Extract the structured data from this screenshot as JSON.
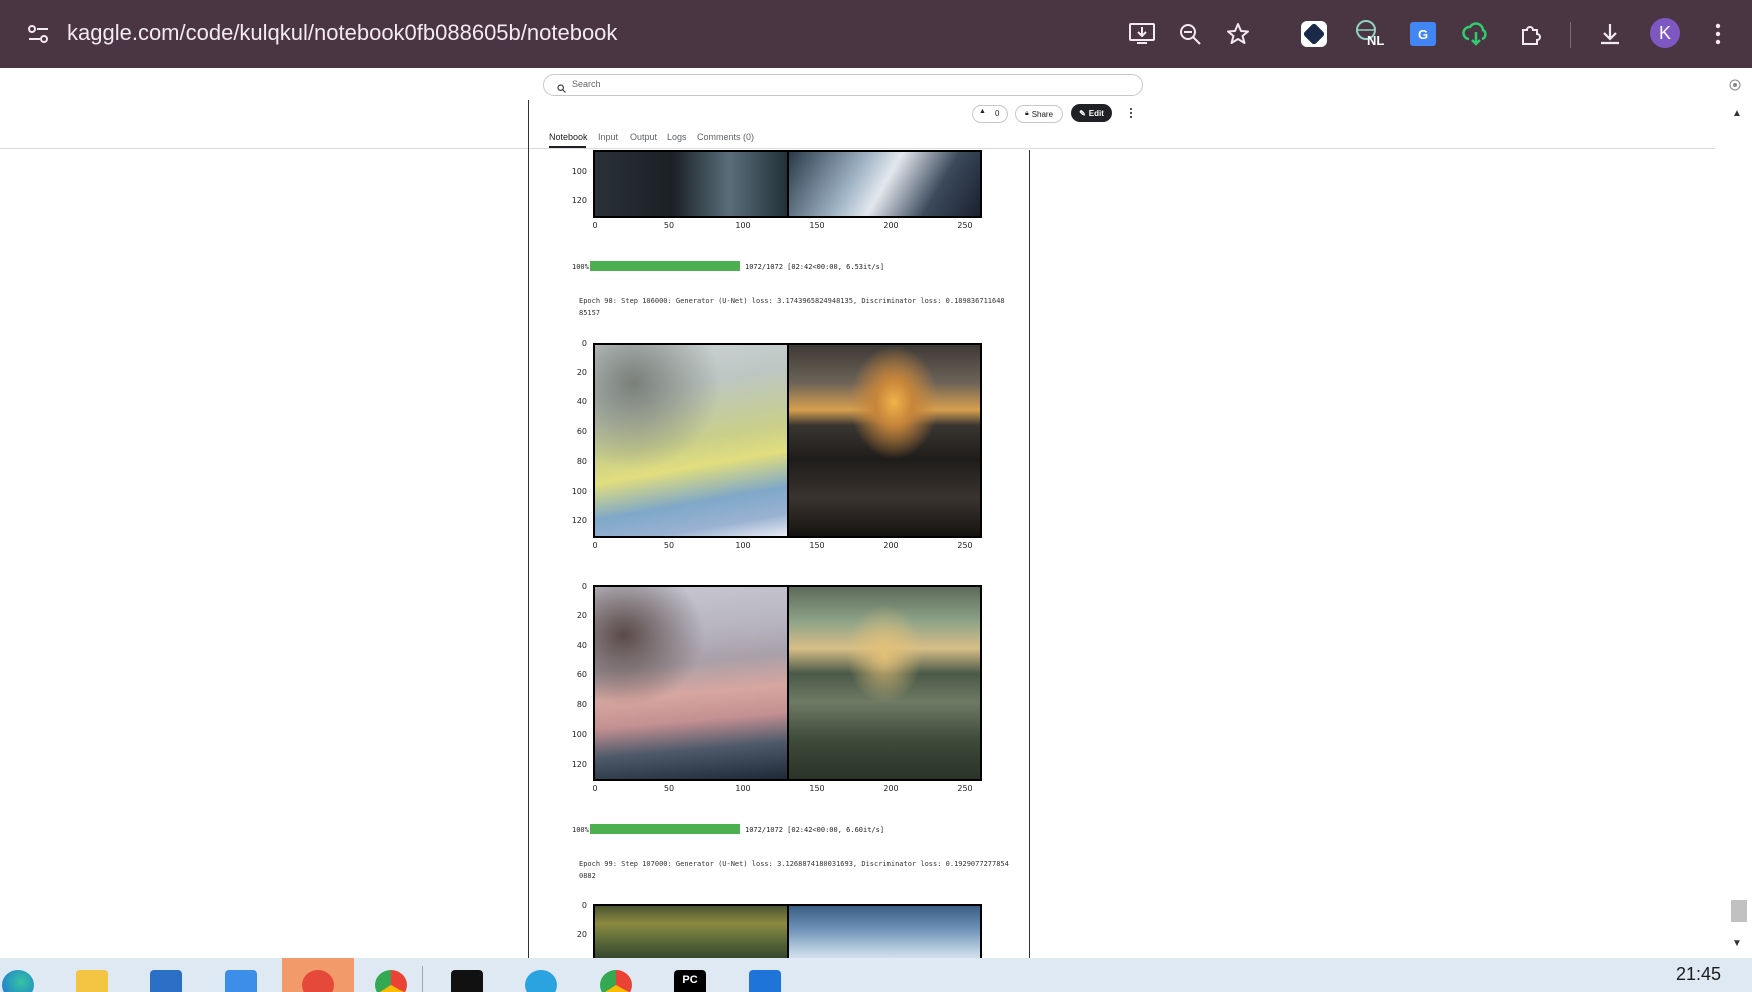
{
  "browser": {
    "url": "kaggle.com/code/kulqkul/notebook0fb088605b/notebook",
    "avatar_letter": "K",
    "toolbar_icons": [
      "install-app-icon",
      "zoom-icon",
      "bookmark-star-icon",
      "extension-dark-icon",
      "extension-nl-icon",
      "google-translate-icon",
      "cloud-download-icon",
      "extensions-puzzle-icon",
      "downloads-icon",
      "profile-avatar",
      "chrome-menu-icon"
    ],
    "nl_badge": "NL"
  },
  "kaggle": {
    "search_placeholder": "Search",
    "vote_count": "0",
    "share_label": "Share",
    "edit_label": "Edit",
    "tabs": [
      {
        "label": "Notebook"
      },
      {
        "label": "Input"
      },
      {
        "label": "Output"
      },
      {
        "label": "Logs"
      },
      {
        "label": "Comments (0)"
      }
    ]
  },
  "output": {
    "progress1": {
      "percent_label": "100%",
      "stats": "1072/1072 [02:42<00:00,  6.53it/s]",
      "fraction": 1.0
    },
    "log1_line1": "Epoch 98: Step 106000: Generator (U-Net) loss: 3.1743965824948135, Discriminator loss: 0.189836711648",
    "log1_line2": "85157",
    "progress2": {
      "percent_label": "100%",
      "stats": "1072/1072 [02:42<00:00,  6.60it/s]",
      "fraction": 1.0
    },
    "log2_line1": "Epoch 99: Step 107000: Generator (U-Net) loss: 3.1268874180031693, Discriminator loss: 0.1929077277854",
    "log2_line2": "0882",
    "x_ticks": [
      "0",
      "50",
      "100",
      "150",
      "200",
      "250"
    ],
    "y_ticks_full": [
      "0",
      "20",
      "40",
      "60",
      "80",
      "100",
      "120"
    ],
    "y_ticks_top_partial": [
      "100",
      "120"
    ],
    "y_ticks_bottom_partial": [
      "0",
      "20"
    ]
  },
  "taskbar": {
    "clock": "21:45",
    "apps": [
      "edge-icon",
      "file-explorer-icon",
      "microsoft-store-icon",
      "mail-icon",
      "wps-office-icon",
      "chrome-icon",
      "security-icon",
      "telegram-icon",
      "chrome-profile-icon",
      "pycharm-icon",
      "media-app-icon"
    ]
  },
  "colors": {
    "browser_bar": "#4a3543",
    "progress_green": "#4caf50",
    "edit_button": "#202124"
  }
}
